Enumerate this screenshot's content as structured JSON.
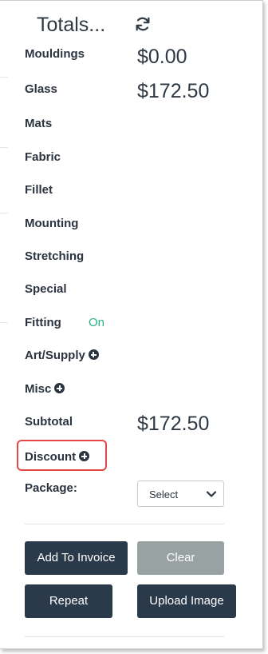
{
  "header": {
    "title": "Totals...",
    "refresh_icon": "refresh-icon"
  },
  "rows": {
    "mouldings": {
      "label": "Mouldings",
      "value": "$0.00"
    },
    "glass": {
      "label": "Glass",
      "value": "$172.50"
    },
    "mats": {
      "label": "Mats"
    },
    "fabric": {
      "label": "Fabric"
    },
    "fillet": {
      "label": "Fillet"
    },
    "mounting": {
      "label": "Mounting"
    },
    "stretching": {
      "label": "Stretching"
    },
    "special": {
      "label": "Special"
    },
    "fitting": {
      "label": "Fitting",
      "status": "On"
    },
    "art_supply": {
      "label": "Art/Supply"
    },
    "misc": {
      "label": "Misc"
    },
    "subtotal": {
      "label": "Subtotal",
      "value": "$172.50"
    },
    "discount": {
      "label": "Discount"
    },
    "package": {
      "label": "Package:",
      "select_value": "Select"
    }
  },
  "buttons": {
    "add_to_invoice": "Add To Invoice",
    "clear": "Clear",
    "repeat": "Repeat",
    "upload_image": "Upload Image"
  },
  "colors": {
    "accent_green": "#2bb38a",
    "button_dark": "#2b3a4a",
    "button_disabled": "#98a2a3",
    "highlight_red": "#e34848"
  }
}
